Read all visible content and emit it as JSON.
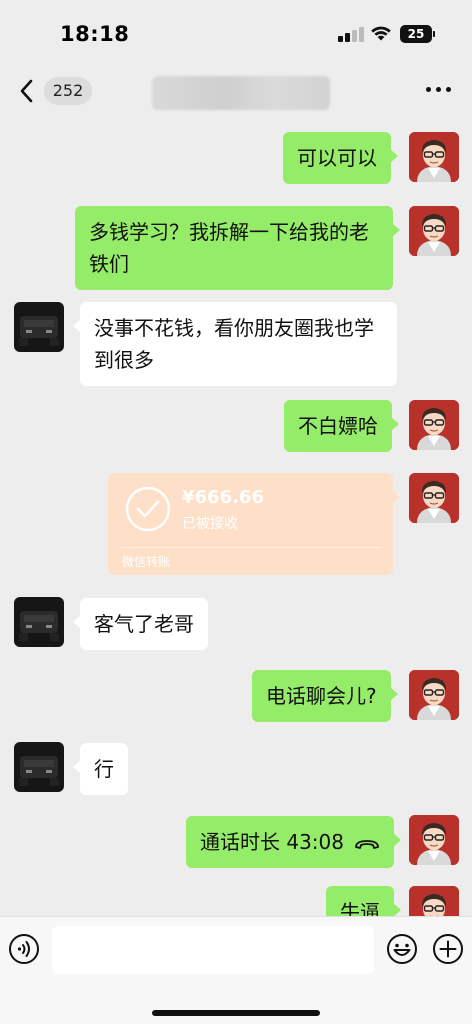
{
  "status_bar": {
    "time": "18:18",
    "battery": "25"
  },
  "nav": {
    "unread_count": "252",
    "icons": [
      "back-icon",
      "more-icon"
    ]
  },
  "messages": [
    {
      "type": "text",
      "sender": "me",
      "text": "可以可以"
    },
    {
      "type": "text",
      "sender": "me",
      "text": "多钱学习？我拆解一下给我的老铁们"
    },
    {
      "type": "text",
      "sender": "other",
      "text": "没事不花钱，看你朋友圈我也学到很多"
    },
    {
      "type": "text",
      "sender": "me",
      "text": "不白嫖哈"
    },
    {
      "type": "transfer",
      "sender": "me",
      "amount": "¥666.66",
      "status": "已被接收",
      "label": "微信转账"
    },
    {
      "type": "text",
      "sender": "other",
      "text": "客气了老哥"
    },
    {
      "type": "text",
      "sender": "me",
      "text": "电话聊会儿?"
    },
    {
      "type": "text",
      "sender": "other",
      "text": "行"
    },
    {
      "type": "call",
      "sender": "me",
      "text": "通话时长 43:08"
    },
    {
      "type": "text",
      "sender": "me",
      "text": "牛逼"
    }
  ],
  "input_bar": {
    "placeholder": "",
    "icons": [
      "voice-icon",
      "emoji-icon",
      "plus-icon"
    ]
  },
  "colors": {
    "my_bubble": "#95ec69",
    "other_bubble": "#ffffff",
    "transfer_card": "#fde0c7",
    "background": "#ededed"
  }
}
